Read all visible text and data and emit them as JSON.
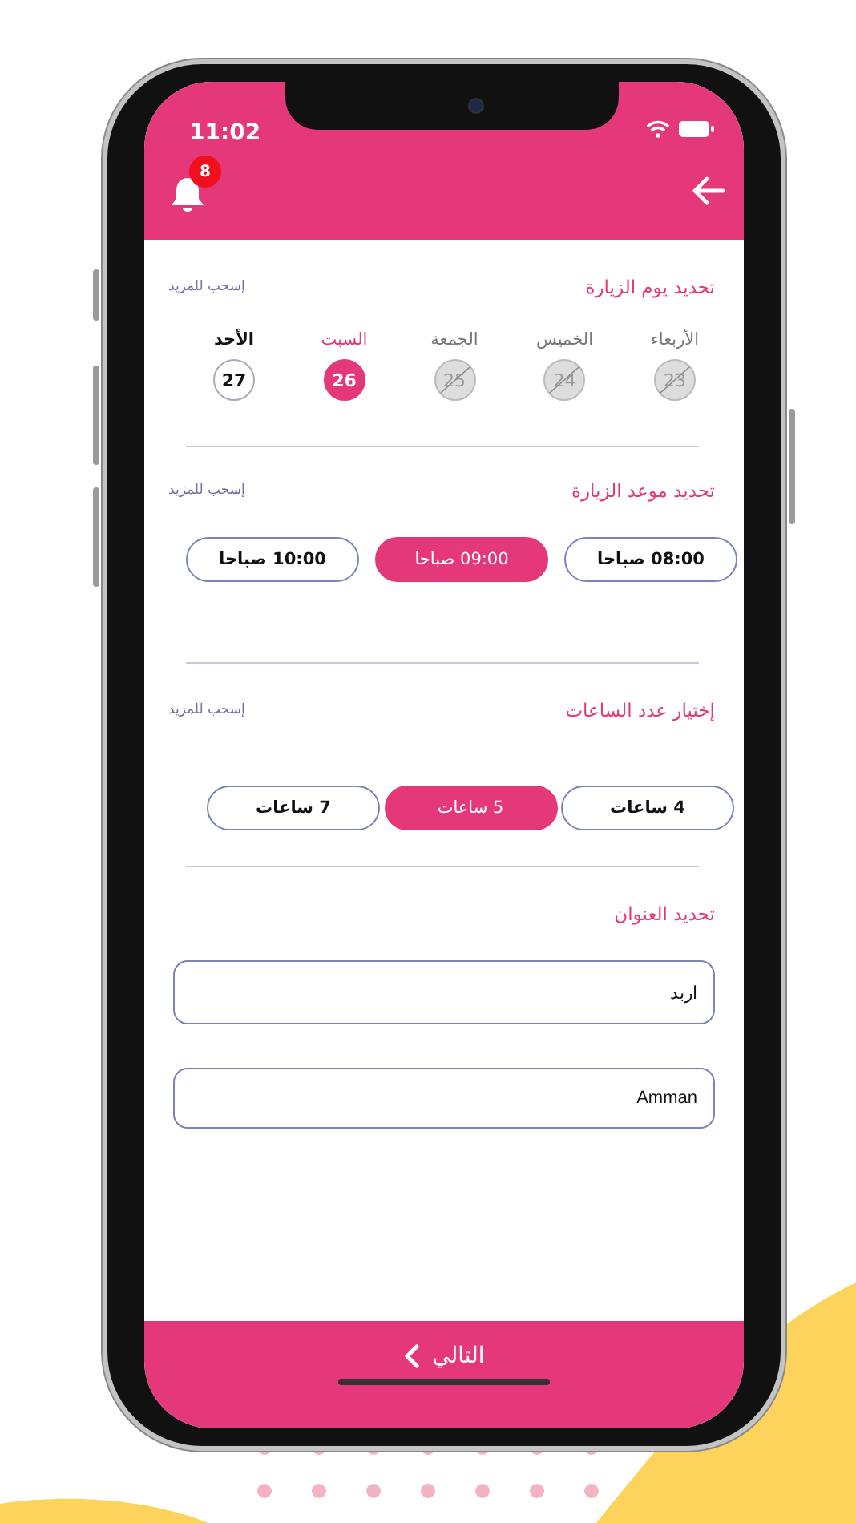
{
  "status_bar": {
    "time": "11:02"
  },
  "header": {
    "notification_count": "8"
  },
  "sections": [
    {
      "kind": "days",
      "title": "تحديد يوم الزيارة",
      "hint": "إسحب للمزيد",
      "days": [
        {
          "name": "الأربعاء",
          "date": "23",
          "disabled": true,
          "selected": false
        },
        {
          "name": "الخميس",
          "date": "24",
          "disabled": true,
          "selected": false
        },
        {
          "name": "الجمعة",
          "date": "25",
          "disabled": true,
          "selected": false
        },
        {
          "name": "السبت",
          "date": "26",
          "disabled": false,
          "selected": true
        },
        {
          "name": "الأحد",
          "date": "27",
          "disabled": false,
          "selected": false
        }
      ]
    },
    {
      "kind": "pills",
      "title": "تحديد موعد الزيارة",
      "hint": "إسحب للمزيد",
      "options": [
        {
          "label": "08:00 صباحا",
          "selected": false
        },
        {
          "label": "09:00 صباحا",
          "selected": true
        },
        {
          "label": "10:00 صباحا",
          "selected": false
        }
      ]
    },
    {
      "kind": "pills",
      "title": "إختيار عدد الساعات",
      "hint": "إسحب للمزيد",
      "options": [
        {
          "label": "4 ساعات",
          "selected": false
        },
        {
          "label": "5 ساعات",
          "selected": true
        },
        {
          "label": "7 ساعات",
          "selected": false
        }
      ]
    },
    {
      "kind": "address",
      "title": "تحديد العنوان",
      "fields": [
        {
          "value": "اربد"
        },
        {
          "value": "Amman"
        }
      ]
    }
  ],
  "next_button": {
    "label": "التالي"
  }
}
